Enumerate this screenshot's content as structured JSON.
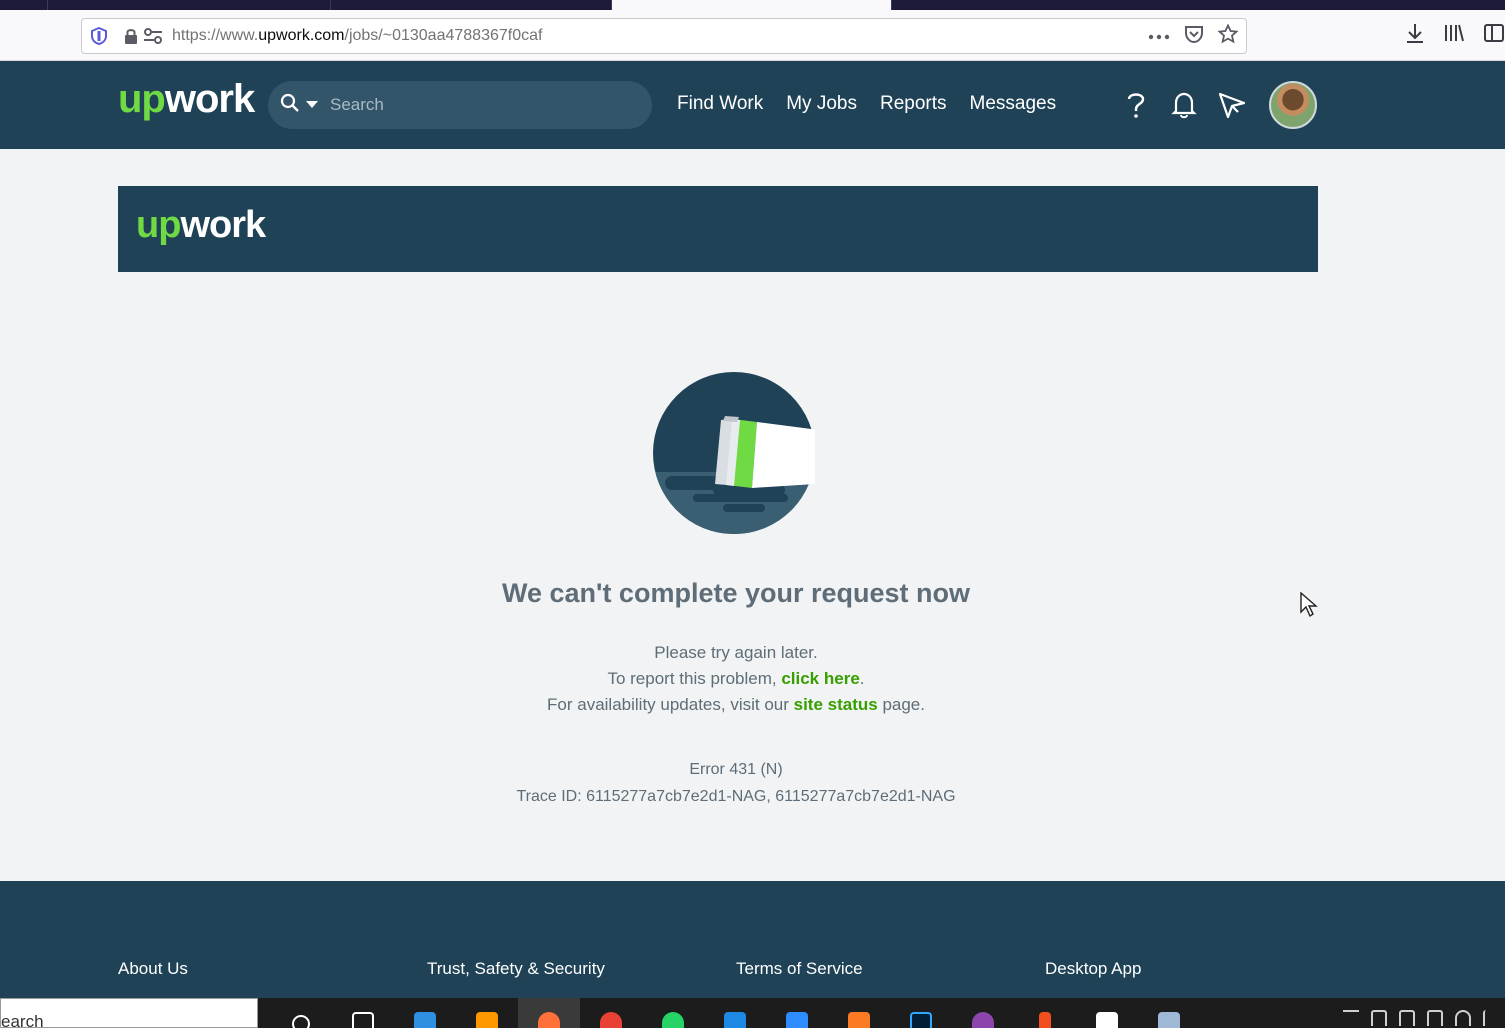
{
  "browser": {
    "url_prefix": "https://www.",
    "url_host": "upwork.com",
    "url_path": "/jobs/~0130aa4788367f0caf"
  },
  "header": {
    "logo_up": "up",
    "logo_work": "work",
    "search_placeholder": "Search",
    "nav": [
      "Find Work",
      "My Jobs",
      "Reports",
      "Messages"
    ]
  },
  "banner": {
    "logo_up": "up",
    "logo_work": "work"
  },
  "error": {
    "title": "We can't complete your request now",
    "line1": "Please try again later.",
    "line2_prefix": "To report this problem, ",
    "line2_link": "click here",
    "line2_suffix": ".",
    "line3_prefix": "For availability updates, visit our ",
    "line3_link": "site status",
    "line3_suffix": " page.",
    "code": "Error 431 (N)",
    "trace": "Trace ID: 6115277a7cb7e2d1-NAG, 6115277a7cb7e2d1-NAG"
  },
  "footer": {
    "links": [
      "About Us",
      "Trust, Safety & Security",
      "Terms of Service",
      "Desktop App"
    ]
  },
  "taskbar": {
    "search_text": "earch"
  },
  "colors": {
    "brand_dark": "#1f4256",
    "brand_green": "#6fda44",
    "link_green": "#37a000"
  }
}
